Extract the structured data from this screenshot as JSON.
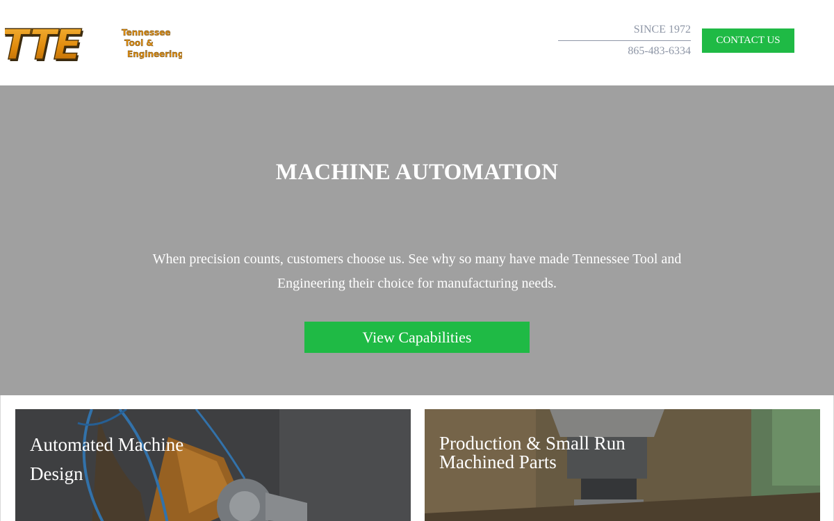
{
  "header": {
    "logo_text": "TTE",
    "logo_subtext": [
      "Tennessee",
      "Tool &",
      "Engineering"
    ],
    "since": "SINCE 1972",
    "phone": "865-483-6334",
    "contact_label": "CONTACT US"
  },
  "hero": {
    "title": "MACHINE AUTOMATION",
    "text": "When precision counts, customers choose us. See why so many have made Tennessee Tool and Engineering their choice for manufacturing needs.",
    "button_label": "View Capabilities"
  },
  "cards": [
    {
      "title": "Automated Machine Design"
    },
    {
      "title": "Production & Small Run Machined Parts"
    }
  ],
  "colors": {
    "accent_green": "#1fba45",
    "hero_gray": "#a0a0a0",
    "muted_text": "#8e96a6",
    "logo_orange": "#e8920f"
  }
}
